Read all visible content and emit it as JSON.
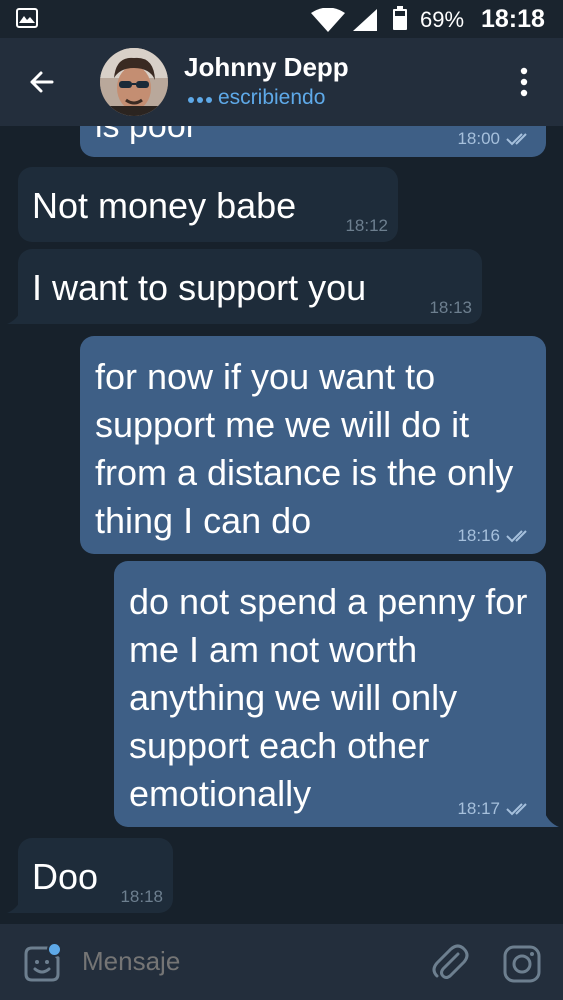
{
  "status_bar": {
    "battery_percent": "69%",
    "battery_level": 0.69,
    "time": "18:18"
  },
  "header": {
    "contact_name": "Johnny Depp",
    "status": "escribiendo",
    "back_icon": "arrow-left-icon",
    "menu_icon": "more-vert-icon"
  },
  "messages": [
    {
      "direction": "out",
      "text": "is poor",
      "time": "18:00",
      "read": true
    },
    {
      "direction": "in",
      "text": "Not money babe",
      "time": "18:12"
    },
    {
      "direction": "in",
      "text": "I want to support you",
      "time": "18:13"
    },
    {
      "direction": "out",
      "text": "for now if you want to support me we will do it from a distance is the only thing I can do",
      "time": "18:16",
      "read": true
    },
    {
      "direction": "out",
      "text": "do not spend a penny for me I am not worth anything we will only support each other emotionally",
      "time": "18:17",
      "read": true
    },
    {
      "direction": "in",
      "text": "Doo",
      "time": "18:18"
    }
  ],
  "composer": {
    "placeholder": "Mensaje",
    "sticker_icon": "sticker-smile-icon",
    "attach_icon": "paperclip-icon",
    "camera_icon": "instagram-camera-icon"
  },
  "colors": {
    "background": "#17212b",
    "header": "#232e3c",
    "incoming_bubble": "#1e2c3a",
    "outgoing_bubble": "#3e5f86",
    "accent": "#5ea9e8"
  }
}
